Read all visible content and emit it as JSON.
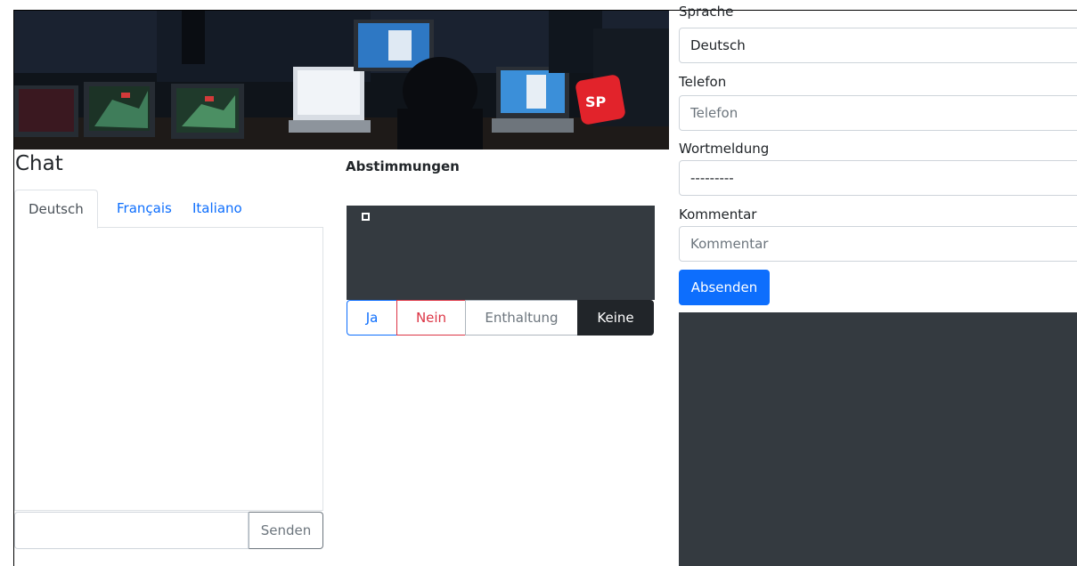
{
  "chat": {
    "title": "Chat",
    "tabs": [
      {
        "label": "Deutsch",
        "active": true
      },
      {
        "label": "Français",
        "active": false
      },
      {
        "label": "Italiano",
        "active": false
      }
    ],
    "input_value": "",
    "send_label": "Senden"
  },
  "banner": {
    "logo_text": "SP"
  },
  "votes": {
    "title": "Abstimmungen",
    "buttons": {
      "yes": "Ja",
      "no": "Nein",
      "abstain": "Enthaltung",
      "none": "Keine"
    }
  },
  "form": {
    "language_label": "Sprache",
    "language_value": "Deutsch",
    "phone_label": "Telefon",
    "phone_placeholder": "Telefon",
    "speech_label": "Wortmeldung",
    "speech_value": "---------",
    "comment_label": "Kommentar",
    "comment_placeholder": "Kommentar",
    "submit_label": "Absenden"
  },
  "colors": {
    "primary": "#0d6efd",
    "danger": "#dc3545",
    "dark": "#343a40"
  }
}
